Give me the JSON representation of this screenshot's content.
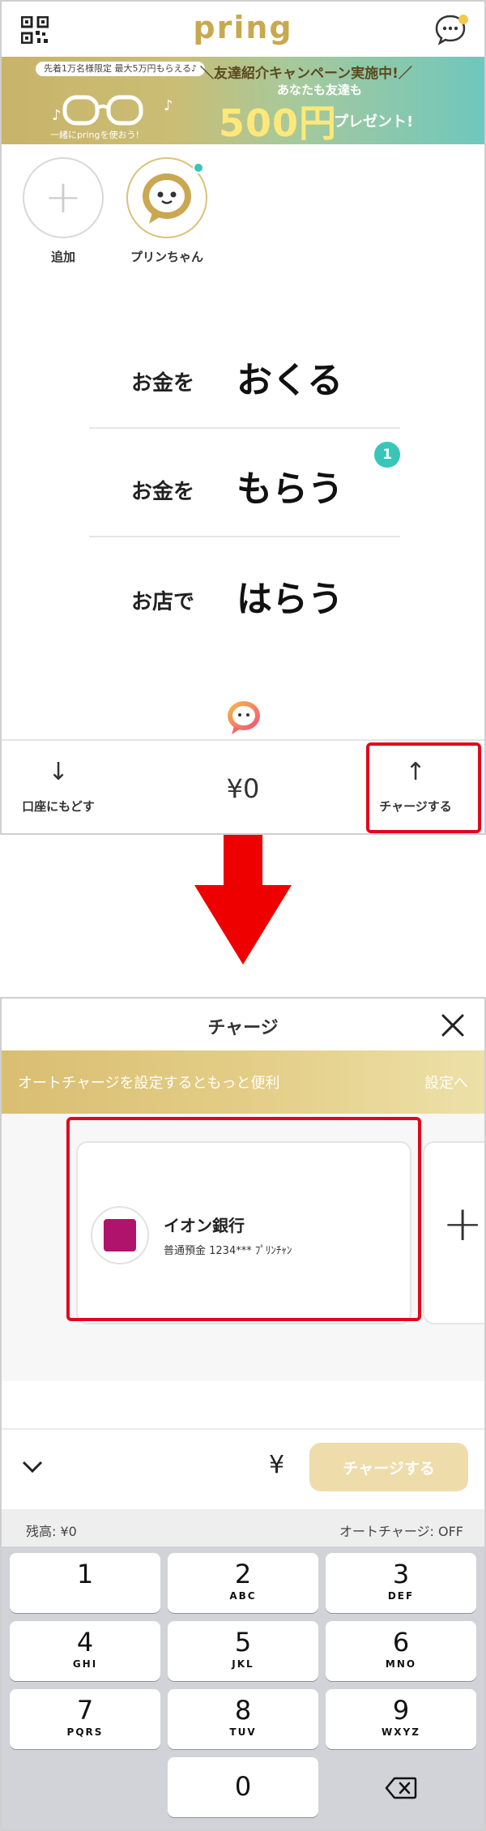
{
  "screen1": {
    "logo": "pring",
    "banner": {
      "tag": "先着1万名様限定 最大5万円もらえる♪",
      "sub": "一緒にpringを使おう!",
      "headline": "＼友達紹介キャンペーン実施中!／",
      "line2": "あなたも友達も",
      "amount": "500円",
      "present": "プレゼント!"
    },
    "friends": [
      {
        "label": "追加"
      },
      {
        "label": "プリンちゃん"
      }
    ],
    "actions": {
      "send": {
        "small": "お金を",
        "big": "おくる"
      },
      "receive": {
        "small": "お金を",
        "big": "もらう",
        "badge": "1"
      },
      "pay": {
        "small": "お店で",
        "big": "はらう"
      }
    },
    "bottom": {
      "back_arrow": "↓",
      "back_label": "口座にもどす",
      "balance": "¥0",
      "charge_arrow": "↑",
      "charge_label": "チャージする"
    }
  },
  "screen2": {
    "title": "チャージ",
    "auto_bar": {
      "message": "オートチャージを設定するともっと便利",
      "link": "設定へ"
    },
    "bank": {
      "name": "イオン銀行",
      "account": "普通預金 1234*** ﾌﾟﾘﾝﾁｬﾝ"
    },
    "add_card": "+",
    "yen": "¥",
    "charge_button": "チャージする",
    "keypad": {
      "balance_label": "残高: ¥0",
      "auto_label": "オートチャージ: OFF",
      "keys": [
        {
          "n": "1",
          "s": ""
        },
        {
          "n": "2",
          "s": "ABC"
        },
        {
          "n": "3",
          "s": "DEF"
        },
        {
          "n": "4",
          "s": "GHI"
        },
        {
          "n": "5",
          "s": "JKL"
        },
        {
          "n": "6",
          "s": "MNO"
        },
        {
          "n": "7",
          "s": "PQRS"
        },
        {
          "n": "8",
          "s": "TUV"
        },
        {
          "n": "9",
          "s": "WXYZ"
        },
        {
          "n": "0",
          "s": ""
        }
      ]
    }
  },
  "colors": {
    "gold": "#c9a850",
    "teal": "#38c6b8",
    "highlight_red": "#e4061c",
    "aeon_magenta": "#b0136c"
  },
  "icons": [
    "qr-code-icon",
    "chat-bubble-icon",
    "close-icon",
    "chevron-down-icon",
    "backspace-icon",
    "down-arrow-icon"
  ]
}
